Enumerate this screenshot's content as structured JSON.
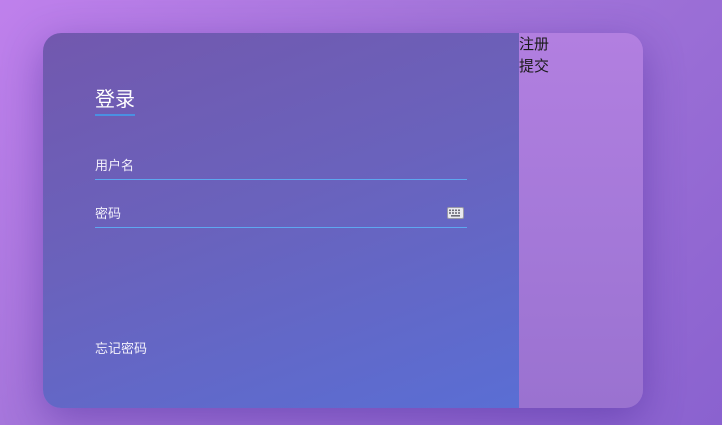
{
  "login": {
    "title": "登录",
    "username_placeholder": "用户名",
    "username_value": "",
    "password_placeholder": "密码",
    "password_value": "",
    "forgot_password": "忘记密码"
  },
  "side": {
    "register_label": "注册",
    "submit_label": "提交"
  },
  "icons": {
    "keyboard": "keyboard-icon"
  },
  "colors": {
    "accent": "#4a90e2",
    "underline": "#5ea7f0"
  }
}
